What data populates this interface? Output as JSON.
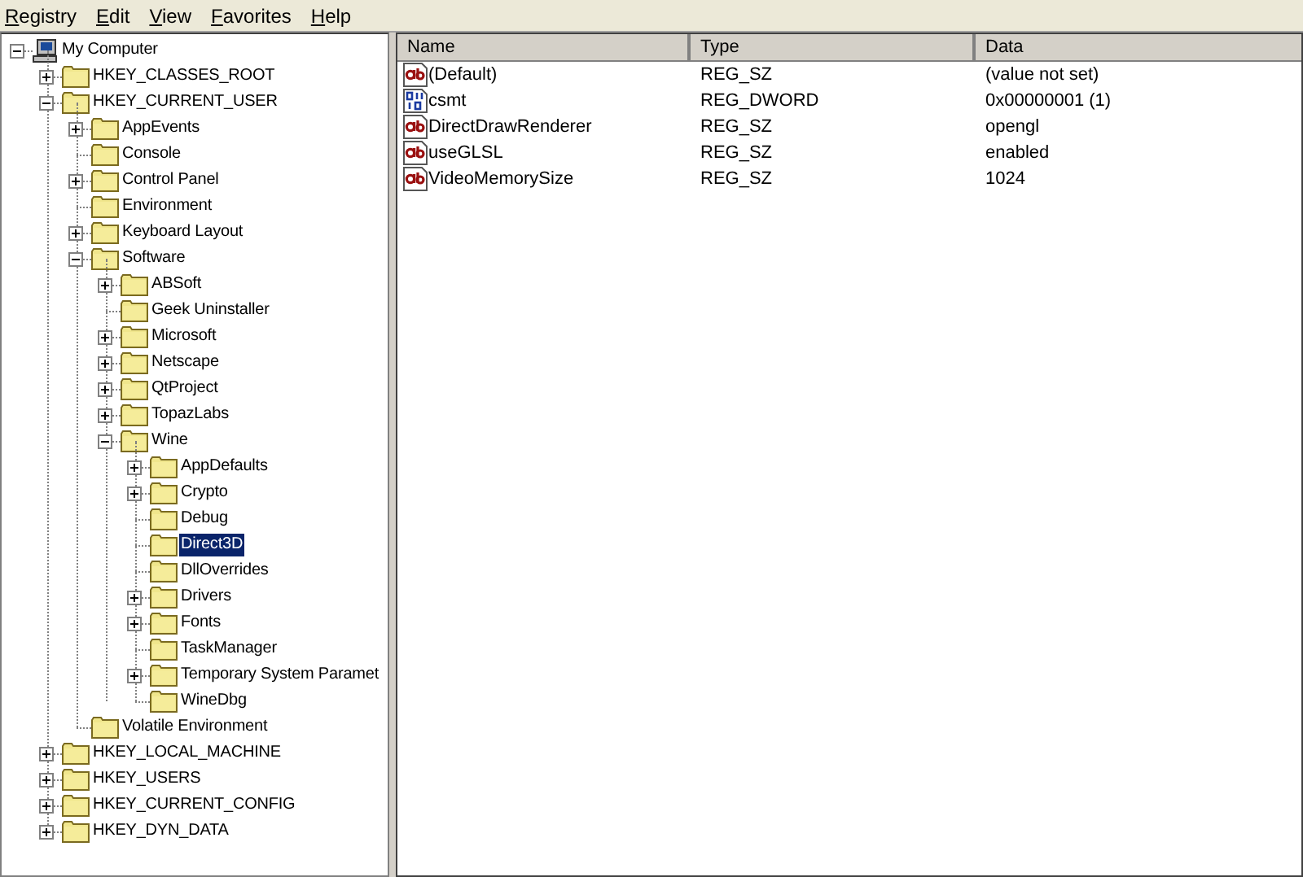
{
  "menu": [
    "Registry",
    "Edit",
    "View",
    "Favorites",
    "Help"
  ],
  "tree": [
    {
      "label": "My Computer",
      "kind": "computer",
      "expanded": true,
      "selected": false,
      "children": [
        {
          "label": "HKEY_CLASSES_ROOT",
          "kind": "folder",
          "expanded": false,
          "selected": false
        },
        {
          "label": "HKEY_CURRENT_USER",
          "kind": "folder",
          "expanded": true,
          "selected": false,
          "children": [
            {
              "label": "AppEvents",
              "kind": "folder",
              "expanded": false,
              "selected": false
            },
            {
              "label": "Console",
              "kind": "folder",
              "selected": false
            },
            {
              "label": "Control Panel",
              "kind": "folder",
              "expanded": false,
              "selected": false
            },
            {
              "label": "Environment",
              "kind": "folder",
              "selected": false
            },
            {
              "label": "Keyboard Layout",
              "kind": "folder",
              "expanded": false,
              "selected": false
            },
            {
              "label": "Software",
              "kind": "folder",
              "expanded": true,
              "selected": false,
              "children": [
                {
                  "label": "ABSoft",
                  "kind": "folder",
                  "expanded": false,
                  "selected": false
                },
                {
                  "label": "Geek Uninstaller",
                  "kind": "folder",
                  "selected": false
                },
                {
                  "label": "Microsoft",
                  "kind": "folder",
                  "expanded": false,
                  "selected": false
                },
                {
                  "label": "Netscape",
                  "kind": "folder",
                  "expanded": false,
                  "selected": false
                },
                {
                  "label": "QtProject",
                  "kind": "folder",
                  "expanded": false,
                  "selected": false
                },
                {
                  "label": "TopazLabs",
                  "kind": "folder",
                  "expanded": false,
                  "selected": false
                },
                {
                  "label": "Wine",
                  "kind": "folder",
                  "expanded": true,
                  "selected": false,
                  "children": [
                    {
                      "label": "AppDefaults",
                      "kind": "folder",
                      "expanded": false,
                      "selected": false
                    },
                    {
                      "label": "Crypto",
                      "kind": "folder",
                      "expanded": false,
                      "selected": false
                    },
                    {
                      "label": "Debug",
                      "kind": "folder",
                      "selected": false
                    },
                    {
                      "label": "Direct3D",
                      "kind": "folder",
                      "selected": true
                    },
                    {
                      "label": "DllOverrides",
                      "kind": "folder",
                      "selected": false
                    },
                    {
                      "label": "Drivers",
                      "kind": "folder",
                      "expanded": false,
                      "selected": false
                    },
                    {
                      "label": "Fonts",
                      "kind": "folder",
                      "expanded": false,
                      "selected": false
                    },
                    {
                      "label": "TaskManager",
                      "kind": "folder",
                      "selected": false
                    },
                    {
                      "label": "Temporary System Paramet",
                      "kind": "folder",
                      "expanded": false,
                      "selected": false
                    },
                    {
                      "label": "WineDbg",
                      "kind": "folder",
                      "selected": false
                    }
                  ]
                }
              ]
            },
            {
              "label": "Volatile Environment",
              "kind": "folder",
              "selected": false
            }
          ]
        },
        {
          "label": "HKEY_LOCAL_MACHINE",
          "kind": "folder",
          "expanded": false,
          "selected": false
        },
        {
          "label": "HKEY_USERS",
          "kind": "folder",
          "expanded": false,
          "selected": false
        },
        {
          "label": "HKEY_CURRENT_CONFIG",
          "kind": "folder",
          "expanded": false,
          "selected": false
        },
        {
          "label": "HKEY_DYN_DATA",
          "kind": "folder",
          "expanded": false,
          "selected": false
        }
      ]
    }
  ],
  "table": {
    "columns": [
      "Name",
      "Type",
      "Data"
    ],
    "rows": [
      {
        "kind": "string",
        "name": "(Default)",
        "type": "REG_SZ",
        "data": "(value not set)"
      },
      {
        "kind": "binary",
        "name": "csmt",
        "type": "REG_DWORD",
        "data": "0x00000001 (1)"
      },
      {
        "kind": "string",
        "name": "DirectDrawRenderer",
        "type": "REG_SZ",
        "data": "opengl"
      },
      {
        "kind": "string",
        "name": "useGLSL",
        "type": "REG_SZ",
        "data": "enabled"
      },
      {
        "kind": "string",
        "name": "VideoMemorySize",
        "type": "REG_SZ",
        "data": "1024"
      }
    ]
  }
}
